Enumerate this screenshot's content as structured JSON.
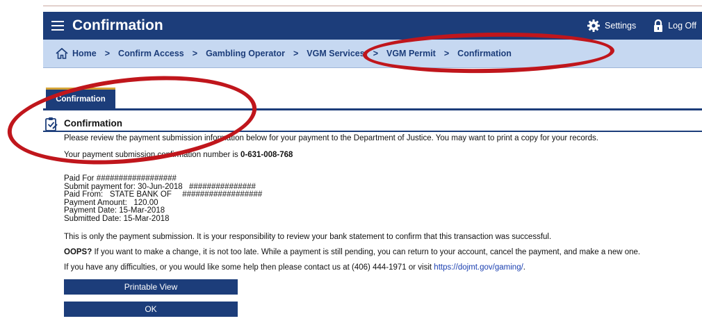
{
  "header": {
    "title": "Confirmation",
    "settings_label": "Settings",
    "logoff_label": "Log Off"
  },
  "breadcrumb": {
    "items": [
      "Home",
      "Confirm Access",
      "Gambling Operator",
      "VGM Services",
      "VGM Permit",
      "Confirmation"
    ],
    "separator": ">"
  },
  "tabs": [
    {
      "label": "Confirmation"
    }
  ],
  "section": {
    "title": "Confirmation",
    "intro": "Please review the payment submission information below for your payment to the Department of Justice. You may want to print a copy for your records.",
    "confirmation_prefix": "Your payment submission confirmation number is ",
    "confirmation_number": "0-631-008-768",
    "details": {
      "paid_for_label": "Paid For",
      "paid_for_value": "##################",
      "submit_for_label": "Submit payment for:",
      "submit_for_value": "30-Jun-2018",
      "submit_for_mask": "###############",
      "paid_from_label": "Paid From:",
      "paid_from_value": "STATE BANK OF",
      "paid_from_mask": "##################",
      "amount_label": "Payment Amount:",
      "amount_value": "120.00",
      "payment_date_label": "Payment Date:",
      "payment_date_value": "15-Mar-2018",
      "submitted_date_label": "Submitted Date:",
      "submitted_date_value": "15-Mar-2018"
    },
    "responsibility_text": "This is only the payment submission. It is your responsibility to review your bank statement to confirm that this transaction was successful.",
    "oops_label": "OOPS?",
    "oops_text": " If you want to make a change, it is not too late. While a payment is still pending, you can return to your account, cancel the payment, and make a new one.",
    "contact_text": "If you have any difficulties, or you would like some help then please contact us at (406) 444-1971 or visit ",
    "contact_link": "https://dojmt.gov/gaming/",
    "contact_end": "."
  },
  "buttons": {
    "printable_view": "Printable View",
    "ok": "OK"
  },
  "colors": {
    "header_bg": "#1c3d7a",
    "breadcrumb_bg": "#c6d8f1",
    "annotation": "#c0161c",
    "tab_accent": "#d4a437"
  }
}
